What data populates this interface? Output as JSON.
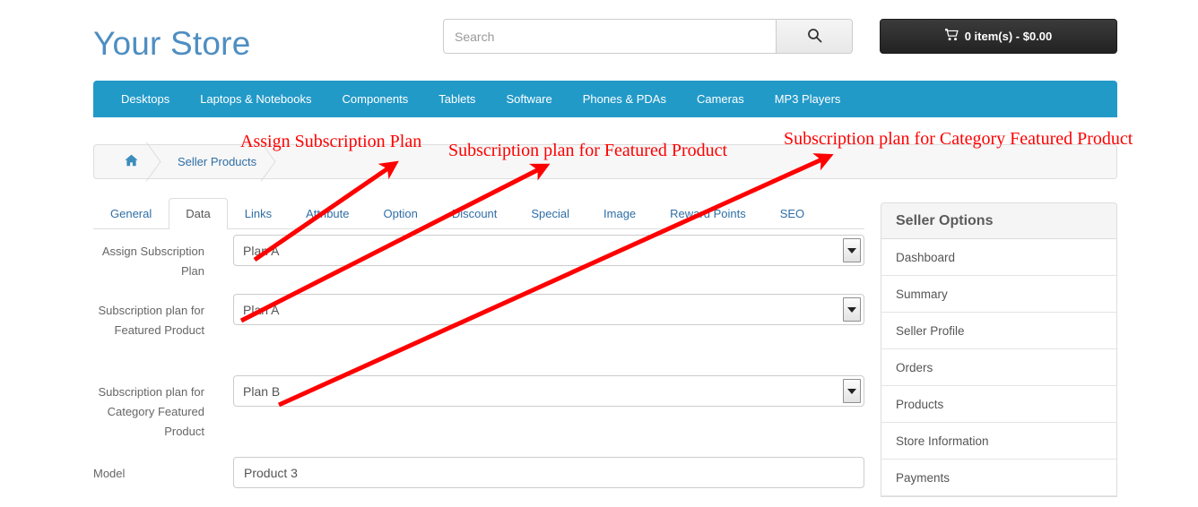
{
  "header": {
    "logo": "Your Store",
    "search": {
      "placeholder": "Search",
      "value": "",
      "icon": "search-icon"
    },
    "cart": {
      "icon": "shopping-cart-icon",
      "label": "0 item(s) - $0.00"
    }
  },
  "nav": {
    "items": [
      {
        "label": "Desktops"
      },
      {
        "label": "Laptops & Notebooks"
      },
      {
        "label": "Components"
      },
      {
        "label": "Tablets"
      },
      {
        "label": "Software"
      },
      {
        "label": "Phones & PDAs"
      },
      {
        "label": "Cameras"
      },
      {
        "label": "MP3 Players"
      }
    ],
    "background": "#229ac8"
  },
  "breadcrumb": {
    "home_icon": "home-icon",
    "items": [
      {
        "label": "Seller Products"
      }
    ]
  },
  "tabs": [
    {
      "label": "General",
      "active": false
    },
    {
      "label": "Data",
      "active": true
    },
    {
      "label": "Links",
      "active": false
    },
    {
      "label": "Attribute",
      "active": false
    },
    {
      "label": "Option",
      "active": false
    },
    {
      "label": "Discount",
      "active": false
    },
    {
      "label": "Special",
      "active": false
    },
    {
      "label": "Image",
      "active": false
    },
    {
      "label": "Reward Points",
      "active": false
    },
    {
      "label": "SEO",
      "active": false
    }
  ],
  "form": {
    "fields": [
      {
        "label": "Assign Subscription Plan",
        "value": "Plan A",
        "type": "select"
      },
      {
        "label": "Subscription plan for Featured Product",
        "value": "Plan A",
        "type": "select"
      },
      {
        "label": "Subscription plan for Category Featured Product",
        "value": "Plan B",
        "type": "select"
      },
      {
        "label": "Model",
        "value": "Product 3",
        "type": "text"
      }
    ]
  },
  "seller_options": {
    "title": "Seller Options",
    "items": [
      {
        "label": "Dashboard"
      },
      {
        "label": "Summary"
      },
      {
        "label": "Seller Profile"
      },
      {
        "label": "Orders"
      },
      {
        "label": "Products"
      },
      {
        "label": "Store Information"
      },
      {
        "label": "Payments"
      }
    ]
  },
  "annotations": {
    "color": "#fe0000",
    "notes": [
      {
        "text": "Assign Subscription Plan"
      },
      {
        "text": "Subscription plan for Featured Product"
      },
      {
        "text": "Subscription plan for Category Featured Product"
      }
    ]
  }
}
